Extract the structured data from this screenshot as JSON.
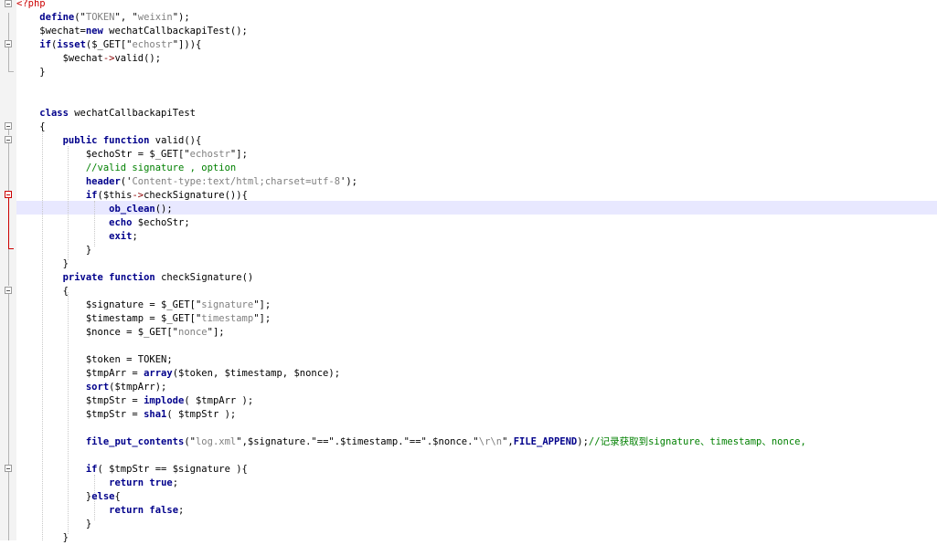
{
  "editor": {
    "language": "php",
    "highlighted_line": 15,
    "colors": {
      "keyword": "#00008b",
      "string": "#808080",
      "comment": "#008000",
      "php_tag": "#cc0000",
      "current_line": "#e8e8ff"
    },
    "lines": [
      [
        {
          "t": "<?php",
          "c": "t"
        }
      ],
      [
        {
          "t": "    "
        },
        {
          "t": "define",
          "c": "k"
        },
        {
          "t": "(\""
        },
        {
          "t": "TOKEN",
          "c": "s"
        },
        {
          "t": "\", \""
        },
        {
          "t": "weixin",
          "c": "s"
        },
        {
          "t": "\");"
        }
      ],
      [
        {
          "t": "    $wechat="
        },
        {
          "t": "new",
          "c": "k"
        },
        {
          "t": " wechatCallbackapiTest();"
        }
      ],
      [
        {
          "t": "    "
        },
        {
          "t": "if",
          "c": "k"
        },
        {
          "t": "("
        },
        {
          "t": "isset",
          "c": "k"
        },
        {
          "t": "($_GET[\""
        },
        {
          "t": "echostr",
          "c": "s"
        },
        {
          "t": "\"])){"
        }
      ],
      [
        {
          "t": "        $wechat"
        },
        {
          "t": "->",
          "c": "o"
        },
        {
          "t": "valid();"
        }
      ],
      [
        {
          "t": "    }"
        }
      ],
      [],
      [],
      [
        {
          "t": "    "
        },
        {
          "t": "class",
          "c": "k"
        },
        {
          "t": " wechatCallbackapiTest"
        }
      ],
      [
        {
          "t": "    {"
        }
      ],
      [
        {
          "t": "        "
        },
        {
          "t": "public",
          "c": "k"
        },
        {
          "t": " "
        },
        {
          "t": "function",
          "c": "k"
        },
        {
          "t": " valid(){"
        }
      ],
      [
        {
          "t": "            $echoStr = $_GET[\""
        },
        {
          "t": "echostr",
          "c": "s"
        },
        {
          "t": "\"];"
        }
      ],
      [
        {
          "t": "            "
        },
        {
          "t": "//valid signature , option",
          "c": "c"
        }
      ],
      [
        {
          "t": "            "
        },
        {
          "t": "header",
          "c": "k"
        },
        {
          "t": "('"
        },
        {
          "t": "Content-type:text/html;charset=utf-8",
          "c": "s"
        },
        {
          "t": "');"
        }
      ],
      [
        {
          "t": "            "
        },
        {
          "t": "if",
          "c": "k"
        },
        {
          "t": "($this"
        },
        {
          "t": "->",
          "c": "o"
        },
        {
          "t": "checkSignature()){"
        }
      ],
      [
        {
          "t": "                "
        },
        {
          "t": "ob_clean",
          "c": "k"
        },
        {
          "t": "();"
        }
      ],
      [
        {
          "t": "                "
        },
        {
          "t": "echo",
          "c": "k"
        },
        {
          "t": " $echoStr;"
        }
      ],
      [
        {
          "t": "                "
        },
        {
          "t": "exit",
          "c": "k"
        },
        {
          "t": ";"
        }
      ],
      [
        {
          "t": "            }"
        }
      ],
      [
        {
          "t": "        }"
        }
      ],
      [
        {
          "t": "        "
        },
        {
          "t": "private",
          "c": "k"
        },
        {
          "t": " "
        },
        {
          "t": "function",
          "c": "k"
        },
        {
          "t": " checkSignature()"
        }
      ],
      [
        {
          "t": "        {"
        }
      ],
      [
        {
          "t": "            $signature = $_GET[\""
        },
        {
          "t": "signature",
          "c": "s"
        },
        {
          "t": "\"];"
        }
      ],
      [
        {
          "t": "            $timestamp = $_GET[\""
        },
        {
          "t": "timestamp",
          "c": "s"
        },
        {
          "t": "\"];"
        }
      ],
      [
        {
          "t": "            $nonce = $_GET[\""
        },
        {
          "t": "nonce",
          "c": "s"
        },
        {
          "t": "\"];"
        }
      ],
      [],
      [
        {
          "t": "            $token = TOKEN;"
        }
      ],
      [
        {
          "t": "            $tmpArr = "
        },
        {
          "t": "array",
          "c": "k"
        },
        {
          "t": "($token, $timestamp, $nonce);"
        }
      ],
      [
        {
          "t": "            "
        },
        {
          "t": "sort",
          "c": "k"
        },
        {
          "t": "($tmpArr);"
        }
      ],
      [
        {
          "t": "            $tmpStr = "
        },
        {
          "t": "implode",
          "c": "k"
        },
        {
          "t": "( $tmpArr );"
        }
      ],
      [
        {
          "t": "            $tmpStr = "
        },
        {
          "t": "sha1",
          "c": "k"
        },
        {
          "t": "( $tmpStr );"
        }
      ],
      [],
      [
        {
          "t": "            "
        },
        {
          "t": "file_put_contents",
          "c": "k"
        },
        {
          "t": "(\""
        },
        {
          "t": "log.xml",
          "c": "s"
        },
        {
          "t": "\",$signature.\"==\".$timestamp.\"==\".$nonce.\""
        },
        {
          "t": "\\r\\n",
          "c": "s"
        },
        {
          "t": "\","
        },
        {
          "t": "FILE_APPEND",
          "c": "k"
        },
        {
          "t": ");"
        },
        {
          "t": "//记录获取到signature、timestamp、nonce,",
          "c": "c"
        }
      ],
      [],
      [
        {
          "t": "            "
        },
        {
          "t": "if",
          "c": "k"
        },
        {
          "t": "( $tmpStr == $signature ){"
        }
      ],
      [
        {
          "t": "                "
        },
        {
          "t": "return",
          "c": "k"
        },
        {
          "t": " "
        },
        {
          "t": "true",
          "c": "k"
        },
        {
          "t": ";"
        }
      ],
      [
        {
          "t": "            }"
        },
        {
          "t": "else",
          "c": "k"
        },
        {
          "t": "{"
        }
      ],
      [
        {
          "t": "                "
        },
        {
          "t": "return",
          "c": "k"
        },
        {
          "t": " "
        },
        {
          "t": "false",
          "c": "k"
        },
        {
          "t": ";"
        }
      ],
      [
        {
          "t": "            }"
        }
      ],
      [
        {
          "t": "        }"
        }
      ]
    ]
  }
}
